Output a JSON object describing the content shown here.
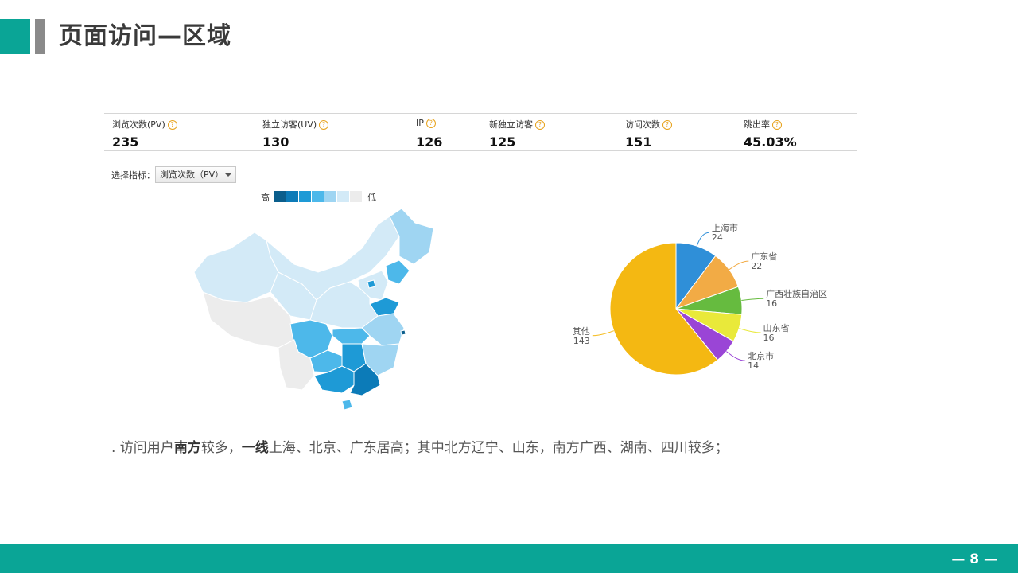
{
  "header": {
    "title": "页面访问—区域"
  },
  "stats": [
    {
      "label": "浏览次数(PV)",
      "value": "235"
    },
    {
      "label": "独立访客(UV)",
      "value": "130"
    },
    {
      "label": "IP",
      "value": "126"
    },
    {
      "label": "新独立访客",
      "value": "125"
    },
    {
      "label": "访问次数",
      "value": "151"
    },
    {
      "label": "跳出率",
      "value": "45.03%"
    }
  ],
  "help_icon": "question-circle-icon",
  "selector": {
    "label": "选择指标：",
    "value": "浏览次数（PV）"
  },
  "map_legend": {
    "high": "高",
    "low": "低",
    "colors": [
      "#0b5e8c",
      "#0c7bb8",
      "#1e9ad6",
      "#4db8ea",
      "#9fd5f2",
      "#d3eaf7",
      "#ececec"
    ]
  },
  "chart_data": [
    {
      "type": "map",
      "title": "",
      "note": "China province choropleth of PV; darker = higher",
      "regions_high": [
        "广东",
        "广西",
        "湖南",
        "四川",
        "山东",
        "辽宁",
        "上海",
        "北京"
      ]
    },
    {
      "type": "pie",
      "title": "",
      "slices": [
        {
          "name": "上海市",
          "value": 24,
          "color": "#2f8fd8"
        },
        {
          "name": "广东省",
          "value": 22,
          "color": "#f2ab45"
        },
        {
          "name": "广西壮族自治区",
          "value": 16,
          "color": "#66bb3f"
        },
        {
          "name": "山东省",
          "value": 16,
          "color": "#e9e93a"
        },
        {
          "name": "北京市",
          "value": 14,
          "color": "#9a45d6"
        },
        {
          "name": "其他",
          "value": 143,
          "color": "#f4b812"
        }
      ]
    }
  ],
  "summary": {
    "prefix": ". 访问用户",
    "b1": "南方",
    "mid": "较多，",
    "b2": "一线",
    "suffix": "上海、北京、广东居高；其中北方辽宁、山东，南方广西、湖南、四川较多；"
  },
  "footer": {
    "page": "— 8 —"
  }
}
